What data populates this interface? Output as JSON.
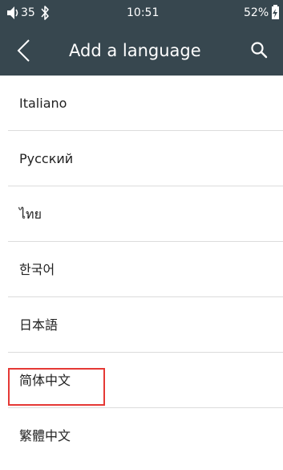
{
  "status_bar": {
    "volume_icon": "volume-icon",
    "volume_level": "35",
    "bluetooth_icon": "bluetooth-icon",
    "time": "10:51",
    "battery_percent": "52%",
    "battery_icon": "battery-charging-icon"
  },
  "toolbar": {
    "back_icon": "chevron-left-icon",
    "title": "Add a language",
    "search_icon": "search-icon"
  },
  "languages": [
    {
      "label": "Italiano"
    },
    {
      "label": "Русский"
    },
    {
      "label": "ไทย"
    },
    {
      "label": "한국어"
    },
    {
      "label": "日本語"
    },
    {
      "label": "简体中文"
    },
    {
      "label": "繁體中文"
    }
  ],
  "colors": {
    "app_bar": "#37474f",
    "highlight": "#e53935",
    "text_primary": "#212121",
    "divider": "#dcdcdc"
  }
}
